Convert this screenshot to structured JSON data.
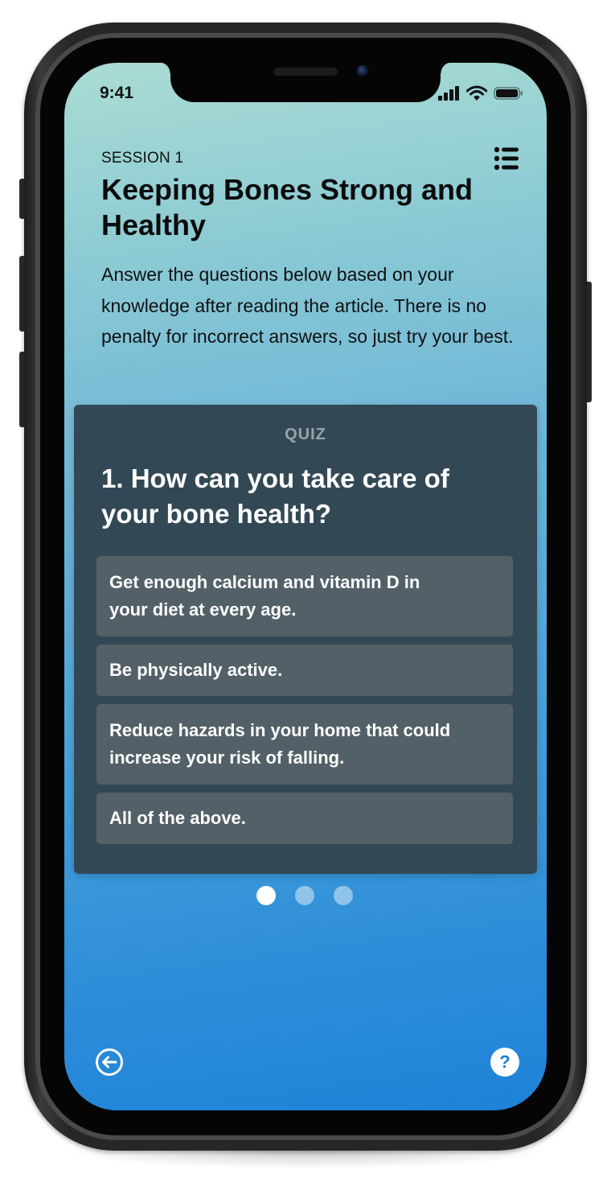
{
  "status_bar": {
    "time": "9:41",
    "icons": [
      "signal-bars-icon",
      "wifi-icon",
      "battery-icon"
    ]
  },
  "header": {
    "session_label": "SESSION 1",
    "title": "Keeping Bones Strong and Healthy",
    "menu_icon": "list-menu-icon"
  },
  "intro": {
    "text": "Answer the questions below based on your knowledge after reading the article. There is no penalty for incorrect answers, so just try your best."
  },
  "quiz": {
    "label": "QUIZ",
    "question": "1. How can you take care of your bone health?",
    "answers": [
      {
        "text": "Get enough calcium and vitamin D in your diet at every age."
      },
      {
        "text": "Be physically active."
      },
      {
        "text": "Reduce hazards in your home that could increase your risk of falling."
      },
      {
        "text": "All of the above."
      }
    ]
  },
  "pagination": {
    "total": 3,
    "current": 1
  },
  "footer": {
    "back_icon": "arrow-left-circle-icon",
    "help_label": "?"
  },
  "colors": {
    "card_background": "#334855",
    "answer_background": "#536068",
    "gradient_top": "#aadcd3",
    "gradient_bottom": "#1e82d8"
  }
}
